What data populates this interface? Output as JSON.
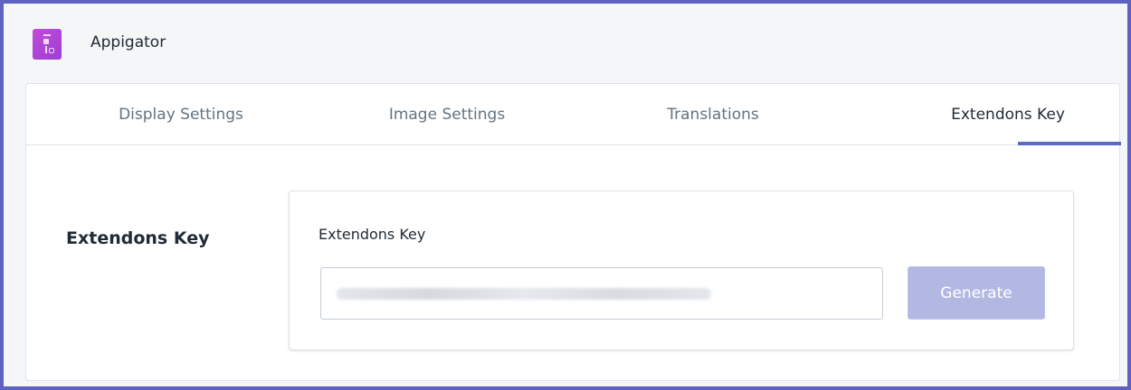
{
  "app": {
    "title": "Appigator",
    "logo": "appigator-logo"
  },
  "tabs": [
    {
      "label": "Display Settings",
      "active": false
    },
    {
      "label": "Image Settings",
      "active": false
    },
    {
      "label": "Translations",
      "active": false
    },
    {
      "label": "Extendons Key",
      "active": true
    }
  ],
  "section": {
    "title": "Extendons Key",
    "field_label": "Extendons Key",
    "key_value": "",
    "key_obscured": true,
    "generate_label": "Generate",
    "generate_disabled": true
  },
  "colors": {
    "frame_border": "#5f62c2",
    "accent": "#5c6ac4",
    "button_disabled": "#b3b8e3",
    "logo": "#b347d6"
  }
}
